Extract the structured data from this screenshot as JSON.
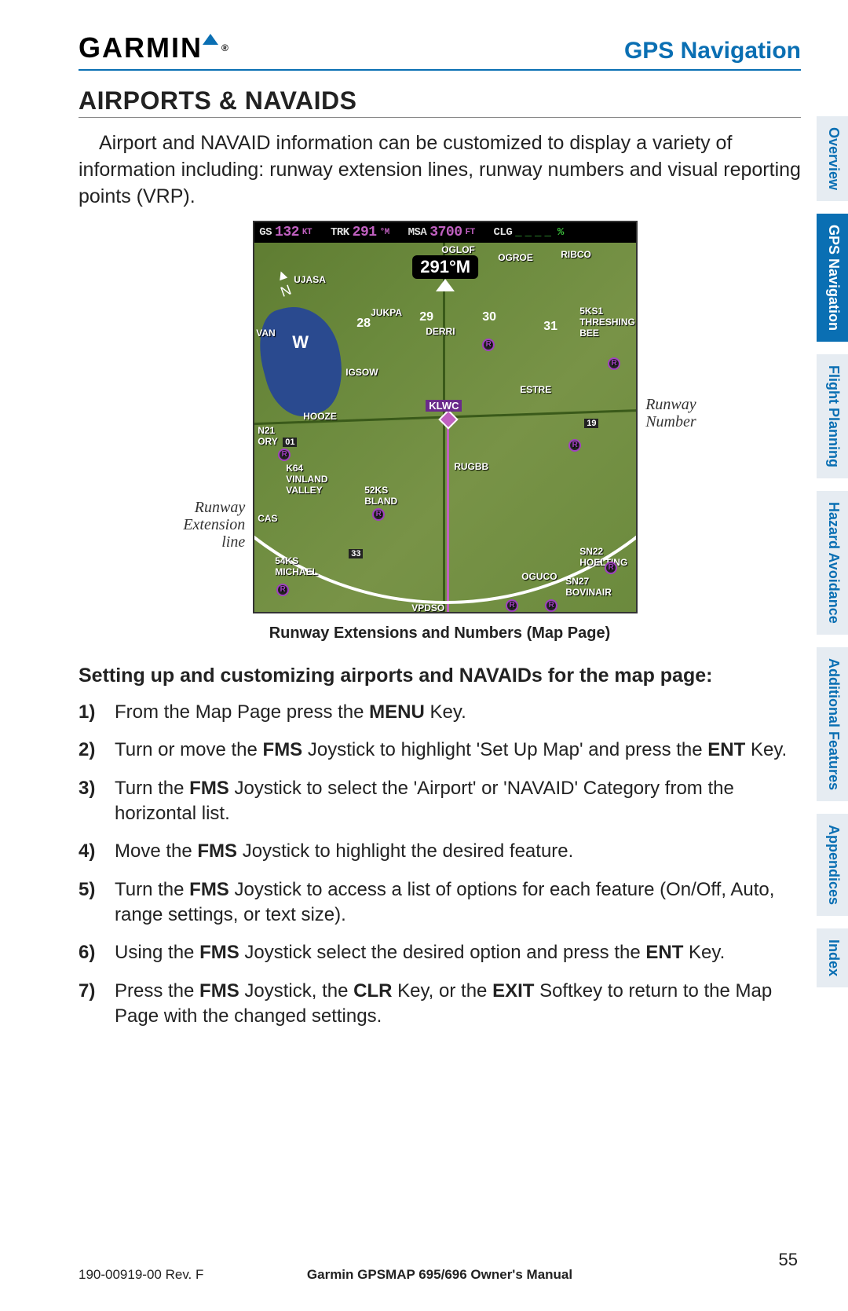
{
  "brand": "GARMIN",
  "header_title": "GPS Navigation",
  "section_title": "AIRPORTS & NAVAIDS",
  "intro_text": "Airport and NAVAID information can be customized to display a variety of information including: runway extension lines, runway numbers and visual reporting points (VRP).",
  "databar": {
    "gs_label": "GS",
    "gs_value": "132",
    "gs_unit": "KT",
    "trk_label": "TRK",
    "trk_value": "291",
    "trk_unit": "°M",
    "msa_label": "MSA",
    "msa_value": "3700",
    "msa_unit": "FT",
    "clg_label": "CLG",
    "clg_value": "____",
    "clg_unit": "%"
  },
  "hsi": {
    "heading": "291°M",
    "ticks": [
      "28",
      "29",
      "30",
      "31",
      "W"
    ]
  },
  "map_waypoints": {
    "top": [
      "OGLOF",
      "OGROE",
      "RIBCO",
      "UJASA",
      "JUKPA",
      "DERRI",
      "5KS1 THRESHING BEE",
      "IGSOW",
      "ESTRE"
    ],
    "mid": [
      "HOOZE",
      "KLWC",
      "N21 ORY",
      "01",
      "19"
    ],
    "low": [
      "K64 VINLAND VALLEY",
      "52KS BLAND",
      "RUGBB",
      "CAS",
      "33",
      "54KS MICHAEL",
      "OGUCO",
      "SN27 BOVINAIR",
      "SN22 HOELTING",
      "VPDSO",
      "VAN"
    ]
  },
  "callouts": {
    "left": "Runway Extension line",
    "right": "Runway Number"
  },
  "figure_caption": "Runway Extensions and Numbers (Map Page)",
  "procedure_title": "Setting up and customizing airports and NAVAIDs for the map page:",
  "steps": [
    "From the Map Page press the <b>MENU</b> Key.",
    "Turn or move the <b>FMS</b> Joystick to highlight 'Set Up Map' and press the <b>ENT</b> Key.",
    "Turn the <b>FMS</b> Joystick to select the 'Airport' or 'NAVAID' Category from the horizontal list.",
    "Move the <b>FMS</b> Joystick to highlight the desired feature.",
    "Turn the <b>FMS</b> Joystick to access a list of options for each feature (On/Off, Auto, range settings, or text size).",
    "Using the <b>FMS</b> Joystick select the desired option and press the <b>ENT</b> Key.",
    "Press the <b>FMS</b> Joystick, the <b>CLR</b> Key, or the <b>EXIT</b> Softkey to return to the Map Page with the changed settings."
  ],
  "footer": {
    "doc_id": "190-00919-00 Rev. F",
    "manual_title": "Garmin GPSMAP 695/696 Owner's Manual",
    "page_number": "55"
  },
  "tabs": [
    "Overview",
    "GPS Navigation",
    "Flight Planning",
    "Hazard Avoidance",
    "Additional Features",
    "Appendices",
    "Index"
  ],
  "active_tab_index": 1
}
